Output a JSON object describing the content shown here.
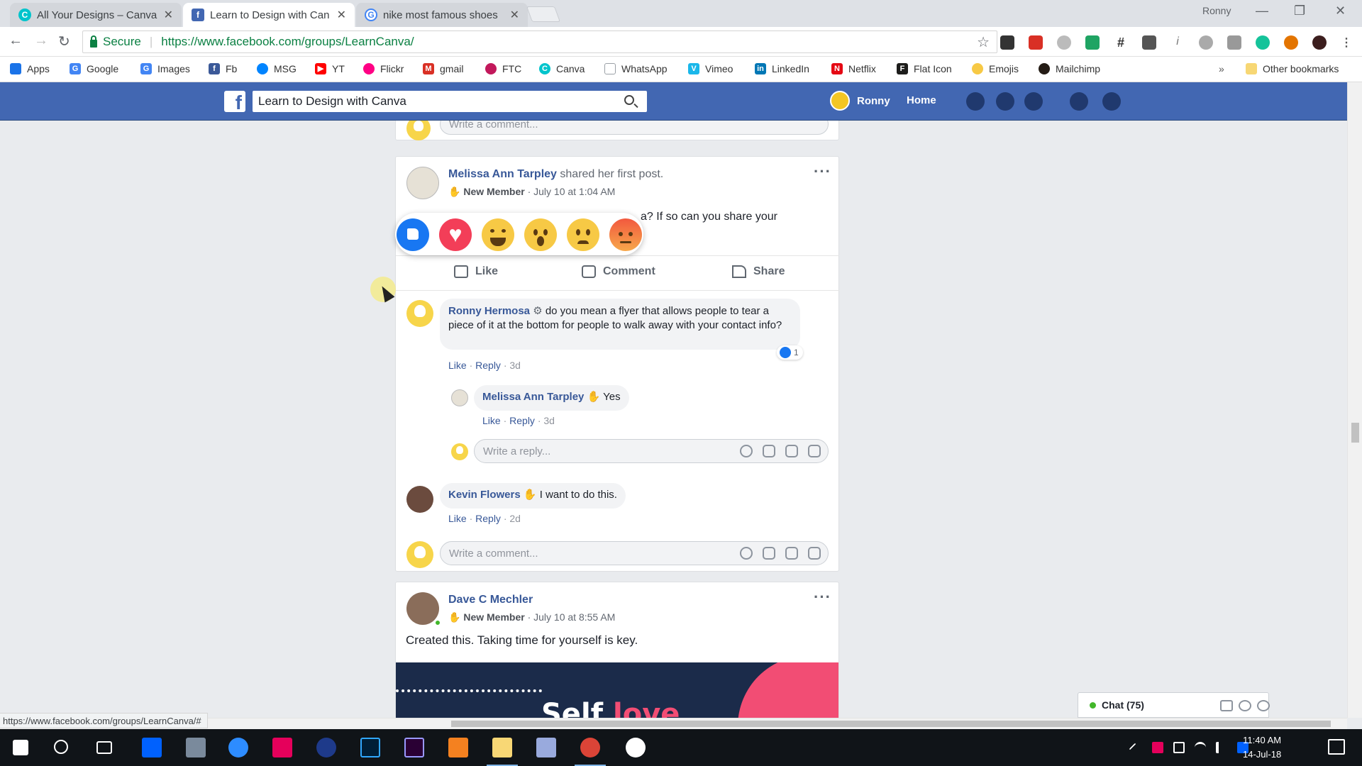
{
  "browser": {
    "tabs": [
      {
        "title": "All Your Designs – Canva",
        "active": false,
        "favicon": "canva-icon",
        "color": "#00c4cc"
      },
      {
        "title": "Learn to Design with Can",
        "active": true,
        "favicon": "facebook-icon",
        "color": "#4267b2"
      },
      {
        "title": "nike most famous shoes",
        "active": false,
        "favicon": "google-icon",
        "color": "#4285f4"
      }
    ],
    "window_user": "Ronny",
    "secure_label": "Secure",
    "url": "https://www.facebook.com/groups/LearnCanva/",
    "status_url": "https://www.facebook.com/groups/LearnCanva/#",
    "bookmarks": [
      {
        "label": "Apps",
        "icon": "apps-grid-icon",
        "color": "#1a73e8"
      },
      {
        "label": "Google",
        "icon": "google-icon",
        "color": "#4285f4"
      },
      {
        "label": "Images",
        "icon": "google-icon",
        "color": "#4285f4"
      },
      {
        "label": "Fb",
        "icon": "facebook-icon",
        "color": "#3b5998"
      },
      {
        "label": "MSG",
        "icon": "messenger-icon",
        "color": "#0084ff"
      },
      {
        "label": "YT",
        "icon": "youtube-icon",
        "color": "#ff0000"
      },
      {
        "label": "Flickr",
        "icon": "flickr-icon",
        "color": "#ff0084"
      },
      {
        "label": "gmail",
        "icon": "gmail-icon",
        "color": "#d93025"
      },
      {
        "label": "FTC",
        "icon": "ftc-icon",
        "color": "#c2185b"
      },
      {
        "label": "Canva",
        "icon": "canva-icon",
        "color": "#00c4cc"
      },
      {
        "label": "WhatsApp",
        "icon": "document-icon",
        "color": "#9aa0a6"
      },
      {
        "label": "Vimeo",
        "icon": "vimeo-icon",
        "color": "#1ab7ea"
      },
      {
        "label": "LinkedIn",
        "icon": "linkedin-icon",
        "color": "#0077b5"
      },
      {
        "label": "Netflix",
        "icon": "netflix-icon",
        "color": "#e50914"
      },
      {
        "label": "Flat Icon",
        "icon": "flaticon-icon",
        "color": "#1d1d1b"
      },
      {
        "label": "Emojis",
        "icon": "emoji-icon",
        "color": "#f7c945"
      },
      {
        "label": "Mailchimp",
        "icon": "mailchimp-icon",
        "color": "#241c15"
      }
    ],
    "overflow_label": "»",
    "other_bookmarks": "Other bookmarks"
  },
  "fb": {
    "search_value": "Learn to Design with Canva",
    "user_name": "Ronny",
    "home_label": "Home"
  },
  "post1": {
    "author": "Melissa Ann Tarpley",
    "action": "shared her first post.",
    "badge": "New Member",
    "time": "July 10 at 1:04 AM",
    "text_visible": "a? If so can you share your",
    "like": "Like",
    "comment": "Comment",
    "share": "Share",
    "top_comment_placeholder": "Write a comment...",
    "comments": [
      {
        "author": "Ronny Hermosa",
        "text": "do you mean a flyer that allows people to tear a piece of it at the bottom for people to walk away with your contact info?",
        "like": "Like",
        "reply": "Reply",
        "time": "3d",
        "like_count": "1"
      },
      {
        "author": "Melissa Ann Tarpley",
        "text": "Yes",
        "like": "Like",
        "reply": "Reply",
        "time": "3d"
      },
      {
        "author": "Kevin Flowers",
        "text": "I want to do this.",
        "like": "Like",
        "reply": "Reply",
        "time": "2d"
      }
    ],
    "reply_placeholder": "Write a reply...",
    "comment_placeholder": "Write a comment..."
  },
  "reactions": [
    "like",
    "love",
    "haha",
    "wow",
    "sad",
    "angry"
  ],
  "post2": {
    "author": "Dave C Mechler",
    "badge": "New Member",
    "time": "July 10 at 8:55 AM",
    "text": "Created this. Taking time for yourself is key.",
    "image_text_a": "Self",
    "image_text_b": "love"
  },
  "chat": {
    "label": "Chat (75)"
  },
  "clock": {
    "time": "11:40 AM",
    "date": "14-Jul-18"
  },
  "colors": {
    "fb_blue": "#4267b2",
    "link": "#385898",
    "page_bg": "#e9ebee"
  }
}
